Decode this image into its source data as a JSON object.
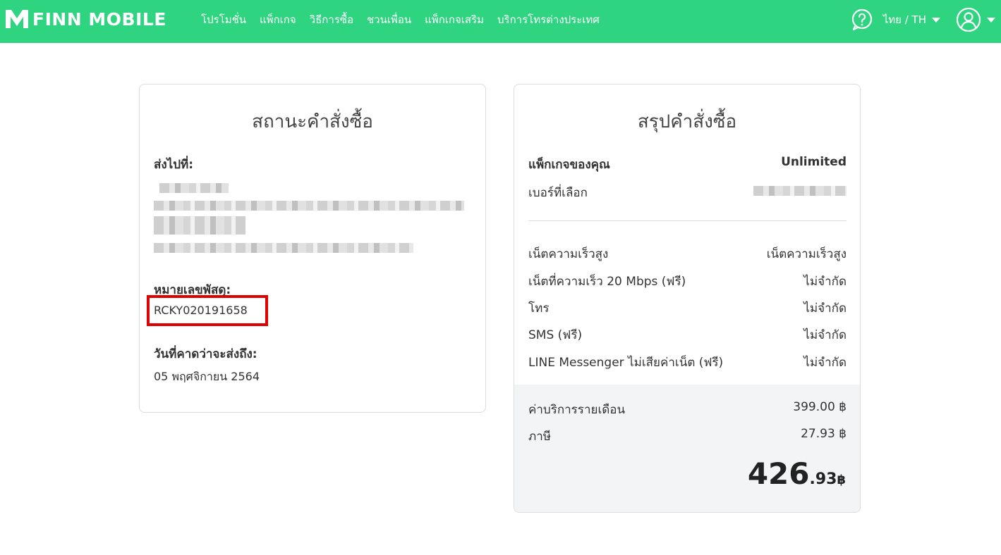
{
  "brand": {
    "name": "FINN MOBILE",
    "color": "#2ed47f"
  },
  "nav": [
    {
      "label": "โปรโมชั่น"
    },
    {
      "label": "แพ็กเกจ"
    },
    {
      "label": "วิธีการซื้อ"
    },
    {
      "label": "ชวนเพื่อน"
    },
    {
      "label": "แพ็กเกจเสริม"
    },
    {
      "label": "บริการโทรต่างประเทศ"
    }
  ],
  "header": {
    "language": "ไทย / TH",
    "help_icon": "help-icon",
    "user_icon": "user-icon"
  },
  "status": {
    "title": "สถานะคำสั่งซื้อ",
    "ship_to_label": "ส่งไปที่:",
    "tracking_label": "หมายเลขพัสดุ:",
    "tracking_number": "RCKY020191658",
    "eta_label": "วันที่คาดว่าจะส่งถึง:",
    "eta_value": "05 พฤศจิกายน 2564",
    "highlight_color": "#e00000"
  },
  "summary": {
    "title": "สรุปคำสั่งซื้อ",
    "package_label": "แพ็กเกจของคุณ",
    "package_value": "Unlimited",
    "number_label": "เบอร์ที่เลือก",
    "features": [
      {
        "label": "เน็ตความเร็วสูง",
        "value": "เน็ตความเร็วสูง"
      },
      {
        "label": "เน็ตที่ความเร็ว 20 Mbps (ฟรี)",
        "value": "ไม่จำกัด"
      },
      {
        "label": "โทร",
        "value": "ไม่จำกัด"
      },
      {
        "label": "SMS (ฟรี)",
        "value": "ไม่จำกัด"
      },
      {
        "label": "LINE Messenger ไม่เสียค่าเน็ต (ฟรี)",
        "value": "ไม่จำกัด"
      }
    ],
    "monthly_label": "ค่าบริการรายเดือน",
    "monthly_value": "399.00 ฿",
    "tax_label": "ภาษี",
    "tax_value": "27.93 ฿",
    "total_int": "426",
    "total_dec": ".93",
    "total_currency": "฿"
  }
}
